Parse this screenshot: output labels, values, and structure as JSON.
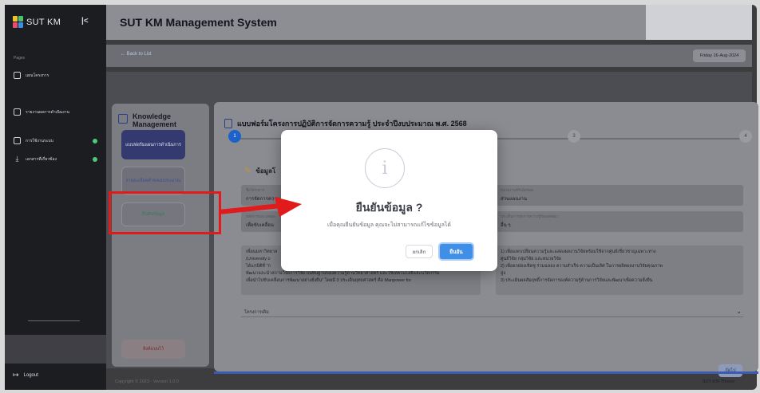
{
  "app": {
    "title": "SUT KM Management System",
    "logo_text": "SUT KM",
    "collapse_glyph": "|<",
    "logo_colors": [
      "#f2c12e",
      "#4bc26b",
      "#e64d6e",
      "#3c8ee6"
    ]
  },
  "sidebar": {
    "section": "Pages",
    "items": [
      {
        "label": "แผนโครงการ",
        "icon": "grid-icon",
        "has_dot": false
      },
      {
        "label": "รายงานผลการดำเนินงาน",
        "icon": "document-icon",
        "has_dot": false
      },
      {
        "label": "การใช้งานระบบ",
        "icon": "settings-icon",
        "has_dot": true
      },
      {
        "label": "เอกสารที่เกี่ยวข้อง",
        "icon": "download-icon",
        "has_dot": true
      }
    ],
    "logout": "Logout"
  },
  "header": {
    "back_link": "← Back to List",
    "date": "Friday 16-Aug-2024"
  },
  "steps_panel": {
    "heading_line1": "Knowledge",
    "heading_line2": "Management",
    "step1": "แบบฟอร์มแผนการดำเนินการ",
    "step2": "รายละเอียดคำของบประมาณ",
    "step3": "ยืนยันข้อมูล",
    "cancel_draft": "ลิงค์แบบไว้"
  },
  "form": {
    "title": "แบบฟอร์มโครงการปฏิบัติการจัดการความรู้ ประจำปีงบประมาณ พ.ศ. 2568",
    "steps": [
      "1",
      "3",
      "4"
    ],
    "section_title": "ข้อมูลโ",
    "field_a_label": "ชื่อโครงการ",
    "field_a_value": "การจัดการความ",
    "field_b_label": "หลักการและเหตุผล",
    "field_b_value": "เพื่อขับเคลื่อน",
    "field_c_label": "หน่วยงานที่รับผิดชอบ",
    "field_c_value": "ส่วนแผนงาน",
    "field_d_label": "ประเด็นการจัดการความรู้ที่สอดคล้อง",
    "field_d_value": "อื่น ๆ",
    "para_left": [
      "เพื่อนมหาวิทยาล",
      "(University o",
      "ได้แก่มิติที่ \"ก",
      "พัฒนาและนำสถานวิจัยการวิจัย บนพื้นฐานของความรู้ด้านวิทยาศาสตร์ และใช้เทคโนโลยีและนวัตกรรม",
      "เพื่อนำไปขับเคลื่อนการพัฒนาอย่างยั่งยืน\" โดยมี 3 ประเด็นยุทธศาสตร์ คือ Manpower for"
    ],
    "para_right": [
      "1)   เพื่อแลกเปลี่ยนความรู้และแสดงผลงานวิจัยพร้อมใช้จากศูนย์เชี่ยวชาญเฉพาะทาง",
      "ศูนย์วิจัย กลุ่มวิจัย และหน่วยวิจัย",
      "2)   เพื่อยกย่องเชิดชู ร่วมฉลอง ความสำเร็จ ความเป็นเลิศ ในการผลิตผลงานวิจัยคุณภาพ",
      "สูง",
      "3)   ประเมินผลสัมฤทธิ์การจัดการองค์ความรู้ด้านการวิจัยและพัฒนาเพื่อความยั่งยืน"
    ],
    "accordion_title": "โครงการเดิม",
    "next_button": "ถัดไป"
  },
  "footer": {
    "copyright": "Copyright © 2023 - Version 1.0.0",
    "theme": "SUT-KM Theme"
  },
  "modal": {
    "title": "ยืนยันข้อมูล ?",
    "message": "เมื่อคุณยืนยันข้อมูล คุณจะไม่สามารถแก้ไขข้อมูลได้",
    "cancel": "ยกเลิก",
    "confirm": "ยืนยัน",
    "info_glyph": "i",
    "accent": "#3f8fe8"
  },
  "annotation": {
    "color": "#e11b1b"
  }
}
